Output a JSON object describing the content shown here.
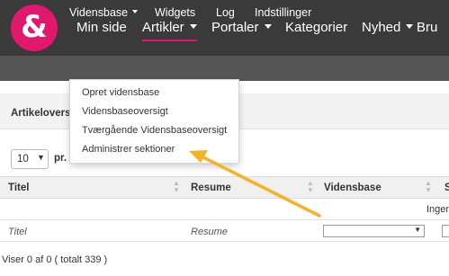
{
  "logo": {
    "glyph": "&",
    "color": "#e2186d"
  },
  "topnav": {
    "items": [
      {
        "label": "Min side",
        "dropdown": false
      },
      {
        "label": "Artikler",
        "dropdown": true,
        "active": true
      },
      {
        "label": "Portaler",
        "dropdown": true
      },
      {
        "label": "Kategorier",
        "dropdown": false
      },
      {
        "label": "Nyhed",
        "dropdown": true
      },
      {
        "label": "Bru",
        "dropdown": false
      }
    ]
  },
  "subnav": {
    "items": [
      {
        "label": "Vidensbase",
        "dropdown": true
      },
      {
        "label": "Widgets"
      },
      {
        "label": "Log"
      },
      {
        "label": "Indstillinger"
      }
    ]
  },
  "dropdown_menu": {
    "items": [
      "Opret vidensbase",
      "Vidensbaseoversigt",
      "Tværgående Vidensbaseoversigt",
      "Administrer sektioner"
    ]
  },
  "panel": {
    "title": "Artikeloversi"
  },
  "length": {
    "value": "10",
    "per_label": "pr. s"
  },
  "table": {
    "headers": [
      "Titel",
      "Resume",
      "Vidensbase",
      "S"
    ],
    "filter_value": "Ingen",
    "row": {
      "titel": "Titel",
      "resume": "Resume"
    }
  },
  "info": "Viser 0 af 0 ( totalt 339 )",
  "colors": {
    "accent": "#e2186d",
    "arrow": "#f5b325",
    "topbar": "#3a3a3a",
    "subbar": "#555555"
  }
}
